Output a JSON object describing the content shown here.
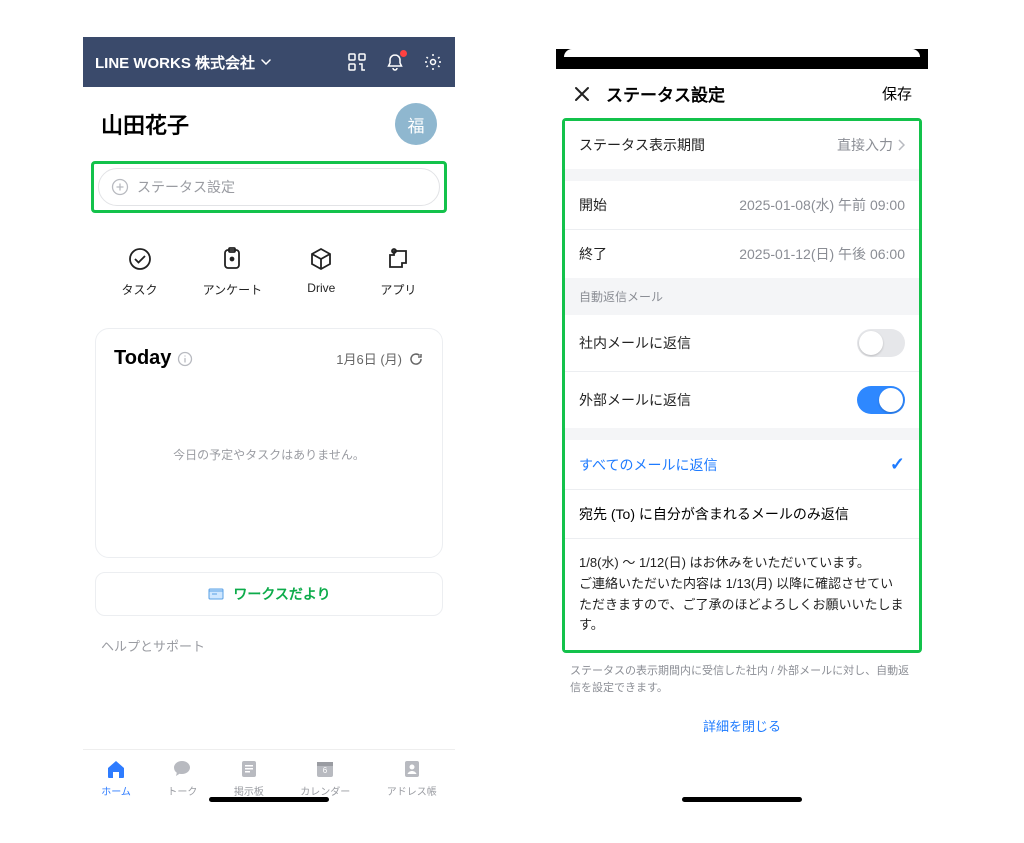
{
  "left": {
    "header": {
      "org_name": "LINE WORKS 株式会社"
    },
    "profile": {
      "name": "山田花子",
      "avatar_char": "福"
    },
    "status_placeholder": "ステータス設定",
    "apps": [
      {
        "id": "task",
        "label": "タスク"
      },
      {
        "id": "survey",
        "label": "アンケート"
      },
      {
        "id": "drive",
        "label": "Drive"
      },
      {
        "id": "apps",
        "label": "アプリ"
      }
    ],
    "today": {
      "title": "Today",
      "date": "1月6日 (月)",
      "empty_text": "今日の予定やタスクはありません。"
    },
    "works_banner": "ワークスだより",
    "help_label": "ヘルプとサポート",
    "tabs": [
      {
        "id": "home",
        "label": "ホーム",
        "active": true
      },
      {
        "id": "talk",
        "label": "トーク"
      },
      {
        "id": "board",
        "label": "掲示板"
      },
      {
        "id": "calendar",
        "label": "カレンダー"
      },
      {
        "id": "contacts",
        "label": "アドレス帳"
      }
    ]
  },
  "right": {
    "header": {
      "title": "ステータス設定",
      "save": "保存"
    },
    "period": {
      "label": "ステータス表示期間",
      "value": "直接入力"
    },
    "start": {
      "label": "開始",
      "value": "2025-01-08(水) 午前 09:00"
    },
    "end": {
      "label": "終了",
      "value": "2025-01-12(日) 午後 06:00"
    },
    "auto_reply_header": "自動返信メール",
    "internal": {
      "label": "社内メールに返信",
      "on": false
    },
    "external": {
      "label": "外部メールに返信",
      "on": true
    },
    "reply_scope": {
      "all": "すべてのメールに返信",
      "to_only": "宛先 (To) に自分が含まれるメールのみ返信",
      "selected": "all"
    },
    "message": "1/8(水) ～ 1/12(日) はお休みをいただいています。\nご連絡いただいた内容は 1/13(月) 以降に確認させていただきますので、ご了承のほどよろしくお願いいたします。",
    "footer_note": "ステータスの表示期間内に受信した社内 / 外部メールに対し、自動返信を設定できます。",
    "footer_link": "詳細を閉じる"
  }
}
